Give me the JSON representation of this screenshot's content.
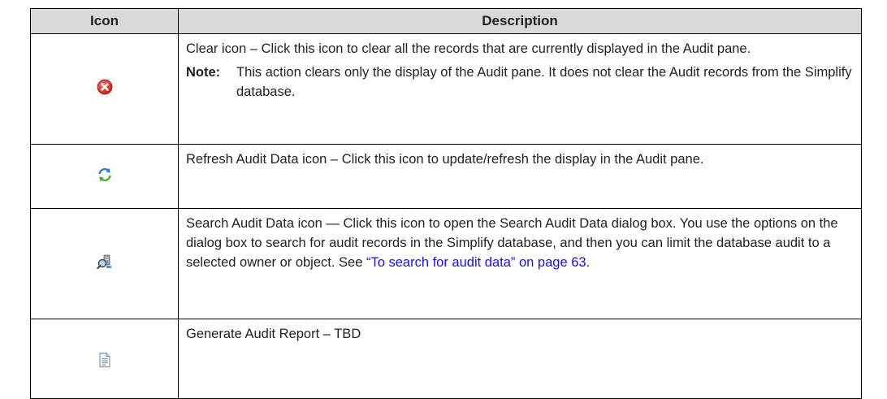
{
  "table": {
    "headers": {
      "icon": "Icon",
      "description": "Description"
    },
    "rows": [
      {
        "icon_name": "clear-icon",
        "text": "Clear icon – Click this icon to clear all the records that are currently displayed in the Audit pane.",
        "note_label": "Note:",
        "note_text": "This action clears only the display of the Audit pane. It does not clear the Audit records from the Simplify database."
      },
      {
        "icon_name": "refresh-icon",
        "text": "Refresh Audit Data icon – Click this icon to update/refresh the display in the Audit pane."
      },
      {
        "icon_name": "search-audit-data-icon",
        "text": "Search Audit Data icon — Click this icon to open the Search Audit Data dialog box. You use the options on the dialog box to search for audit records in the Simplify database, and then you can limit the database audit to a selected owner or object. See ",
        "link_text": "“To search for audit data” on page 63",
        "text_end": "."
      },
      {
        "icon_name": "report-document-icon",
        "text": "Generate Audit Report – TBD"
      }
    ]
  },
  "colors": {
    "header_bg": "#d9d9d9",
    "link": "#1a0dff",
    "clear_icon": "#d9342b"
  }
}
